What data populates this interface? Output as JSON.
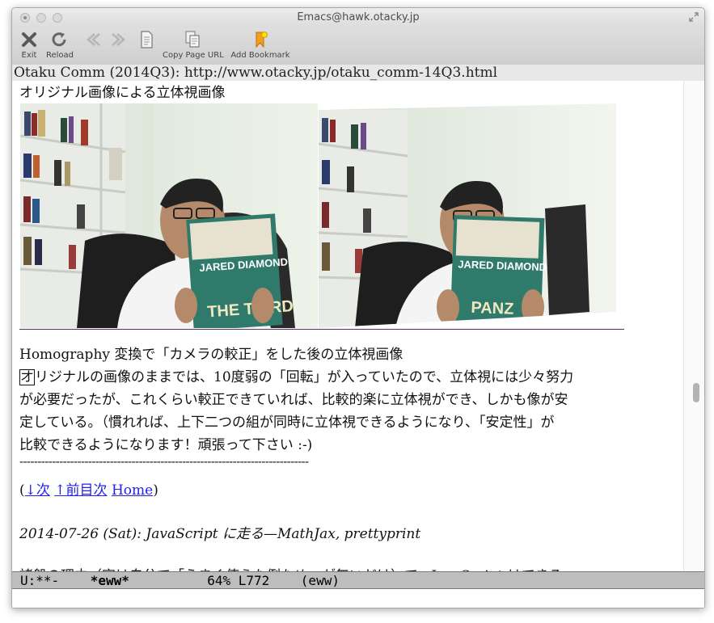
{
  "window": {
    "title": "Emacs@hawk.otacky.jp"
  },
  "toolbar": {
    "items": [
      {
        "label": "Exit",
        "icon": "close-x-icon"
      },
      {
        "label": "Reload",
        "icon": "reload-icon"
      },
      {
        "label": "",
        "icon": "back-icon"
      },
      {
        "label": "",
        "icon": "forward-icon"
      },
      {
        "label": "",
        "icon": "page-icon"
      },
      {
        "label": "Copy Page URL",
        "icon": "copy-page-icon"
      },
      {
        "label": "Add Bookmark",
        "icon": "bookmark-icon"
      }
    ]
  },
  "header_line": "Otaku Comm (2014Q3): http://www.otacky.jp/otaku_comm-14Q3.html",
  "content": {
    "caption_original": "オリジナル画像による立体視画像",
    "images": {
      "book_author": "JARED DIAMOND",
      "book_title_fragment": "THE THIRD",
      "book_title_fragment2": "PANZ"
    },
    "caption_homography": "Homography 変換で「カメラの較正」をした後の立体視画像",
    "paragraph": {
      "cursor_char": "オ",
      "line1_rest": "リジナルの画像のままでは、10度弱の「回転」が入っていたので、立体視には少々努力",
      "line2": "が必要だったが、これくらい較正できていれば、比較的楽に立体視ができ、しかも像が安",
      "line3": "定している。（慣れれば、上下二つの組が同時に立体視できるようになり、「安定性」が",
      "line4": "比較できるようになります！頑張って下さい  :-)"
    },
    "separator": "--------------------------------------------------------------------------------",
    "nav": {
      "open_paren": "(",
      "next": "↓次",
      "prev_toc": "↑前目次",
      "home": "Home",
      "close_paren": ")"
    },
    "entry_heading": "2014-07-26 (Sat): JavaScript に走る—MathJax, prettyprint",
    "partial_line": "諸般の理由（実は自分で「うまく使えた例ため」が無いだけ）で、JavaScript はできる"
  },
  "modeline": {
    "status": "U:**-  ",
    "buffer": "*eww*",
    "position": "64% L772",
    "mode": "(eww)"
  },
  "colors": {
    "link": "#2222ee",
    "modeline_bg": "#bdbdbd",
    "rule": "#5a2a6a"
  }
}
